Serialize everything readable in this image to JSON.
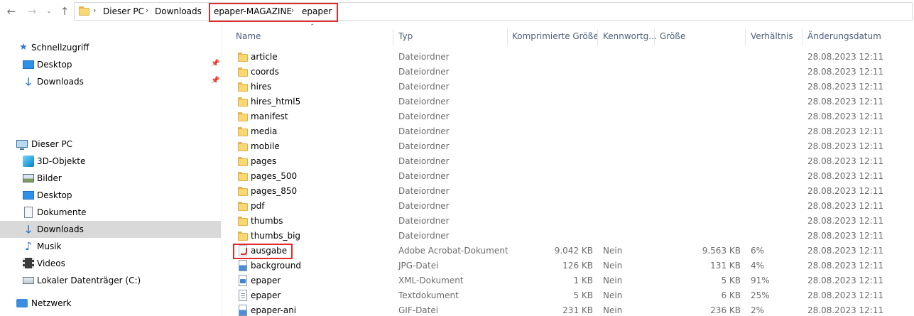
{
  "address": {
    "crumbs": [
      "Dieser PC",
      "Downloads",
      "epaper-MAGAZINE",
      "epaper"
    ]
  },
  "nav": {
    "quick_access": "Schnellzugriff",
    "quick_items": [
      "Desktop",
      "Downloads"
    ],
    "this_pc": "Dieser PC",
    "pc_items": [
      "3D-Objekte",
      "Bilder",
      "Desktop",
      "Dokumente",
      "Downloads",
      "Musik",
      "Videos",
      "Lokaler Datenträger (C:)"
    ],
    "network": "Netzwerk",
    "selected": "Downloads"
  },
  "columns": {
    "name": "Name",
    "type": "Typ",
    "compressed": "Komprimierte Größe",
    "password": "Kennwortg...",
    "size": "Größe",
    "ratio": "Verhältnis",
    "date": "Änderungsdatum"
  },
  "files": [
    {
      "name": "article",
      "icon": "folder-icon",
      "type": "Dateiordner",
      "compressed": "",
      "password": "",
      "size": "",
      "ratio": "",
      "date": "28.08.2023 12:11"
    },
    {
      "name": "coords",
      "icon": "folder-icon",
      "type": "Dateiordner",
      "compressed": "",
      "password": "",
      "size": "",
      "ratio": "",
      "date": "28.08.2023 12:11"
    },
    {
      "name": "hires",
      "icon": "folder-icon",
      "type": "Dateiordner",
      "compressed": "",
      "password": "",
      "size": "",
      "ratio": "",
      "date": "28.08.2023 12:11"
    },
    {
      "name": "hires_html5",
      "icon": "folder-icon",
      "type": "Dateiordner",
      "compressed": "",
      "password": "",
      "size": "",
      "ratio": "",
      "date": "28.08.2023 12:11"
    },
    {
      "name": "manifest",
      "icon": "folder-icon",
      "type": "Dateiordner",
      "compressed": "",
      "password": "",
      "size": "",
      "ratio": "",
      "date": "28.08.2023 12:11"
    },
    {
      "name": "media",
      "icon": "folder-icon",
      "type": "Dateiordner",
      "compressed": "",
      "password": "",
      "size": "",
      "ratio": "",
      "date": "28.08.2023 12:11"
    },
    {
      "name": "mobile",
      "icon": "folder-icon",
      "type": "Dateiordner",
      "compressed": "",
      "password": "",
      "size": "",
      "ratio": "",
      "date": "28.08.2023 12:11"
    },
    {
      "name": "pages",
      "icon": "folder-icon",
      "type": "Dateiordner",
      "compressed": "",
      "password": "",
      "size": "",
      "ratio": "",
      "date": "28.08.2023 12:11"
    },
    {
      "name": "pages_500",
      "icon": "folder-icon",
      "type": "Dateiordner",
      "compressed": "",
      "password": "",
      "size": "",
      "ratio": "",
      "date": "28.08.2023 12:11"
    },
    {
      "name": "pages_850",
      "icon": "folder-icon",
      "type": "Dateiordner",
      "compressed": "",
      "password": "",
      "size": "",
      "ratio": "",
      "date": "28.08.2023 12:11"
    },
    {
      "name": "pdf",
      "icon": "folder-icon",
      "type": "Dateiordner",
      "compressed": "",
      "password": "",
      "size": "",
      "ratio": "",
      "date": "28.08.2023 12:11"
    },
    {
      "name": "thumbs",
      "icon": "folder-icon",
      "type": "Dateiordner",
      "compressed": "",
      "password": "",
      "size": "",
      "ratio": "",
      "date": "28.08.2023 12:11"
    },
    {
      "name": "thumbs_big",
      "icon": "folder-icon",
      "type": "Dateiordner",
      "compressed": "",
      "password": "",
      "size": "",
      "ratio": "",
      "date": "28.08.2023 12:11"
    },
    {
      "name": "ausgabe",
      "icon": "pdf-file-icon",
      "type": "Adobe Acrobat-Dokument",
      "compressed": "9.042 KB",
      "password": "Nein",
      "size": "9.563 KB",
      "ratio": "6%",
      "date": "28.08.2023 12:11"
    },
    {
      "name": "background",
      "icon": "image-file-icon",
      "type": "JPG-Datei",
      "compressed": "126 KB",
      "password": "Nein",
      "size": "131 KB",
      "ratio": "4%",
      "date": "28.08.2023 12:11"
    },
    {
      "name": "epaper",
      "icon": "xml-file-icon",
      "type": "XML-Dokument",
      "compressed": "1 KB",
      "password": "Nein",
      "size": "5 KB",
      "ratio": "91%",
      "date": "28.08.2023 12:11"
    },
    {
      "name": "epaper",
      "icon": "text-file-icon",
      "type": "Textdokument",
      "compressed": "5 KB",
      "password": "Nein",
      "size": "6 KB",
      "ratio": "25%",
      "date": "28.08.2023 12:11"
    },
    {
      "name": "epaper-ani",
      "icon": "image-file-icon",
      "type": "GIF-Datei",
      "compressed": "231 KB",
      "password": "Nein",
      "size": "236 KB",
      "ratio": "2%",
      "date": "28.08.2023 12:11"
    }
  ],
  "colors": {
    "highlight": "#e22b2b",
    "header_text": "#4c607a",
    "selected_nav": "#d9d9d9"
  }
}
